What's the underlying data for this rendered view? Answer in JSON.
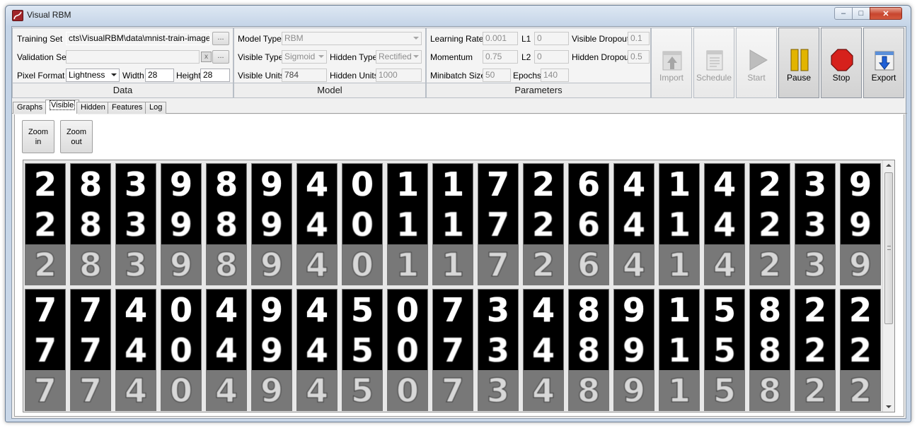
{
  "window": {
    "title": "Visual RBM",
    "minimize": "–",
    "maximize": "□",
    "close": "✕"
  },
  "data_panel": {
    "caption": "Data",
    "training_set_label": "Training Set",
    "training_set_value": "cts\\VisualRBM\\data\\mnist-train-images.idx",
    "validation_set_label": "Validation Set",
    "validation_set_value": "",
    "browse_label": "...",
    "clear_label": "x",
    "pixel_format_label": "Pixel Format",
    "pixel_format_value": "Lightness",
    "width_label": "Width",
    "width_value": "28",
    "height_label": "Height",
    "height_value": "28"
  },
  "model_panel": {
    "caption": "Model",
    "model_type_label": "Model Type",
    "model_type_value": "RBM",
    "visible_type_label": "Visible Type",
    "visible_type_value": "Sigmoid",
    "hidden_type_label": "Hidden Type",
    "hidden_type_value": "Rectified",
    "visible_units_label": "Visible Units",
    "visible_units_value": "784",
    "hidden_units_label": "Hidden Units",
    "hidden_units_value": "1000"
  },
  "parameters_panel": {
    "caption": "Parameters",
    "learning_rate_label": "Learning Rate",
    "learning_rate_value": "0.001",
    "l1_label": "L1",
    "l1_value": "0",
    "visible_dropout_label": "Visible Dropout",
    "visible_dropout_value": "0.1",
    "momentum_label": "Momentum",
    "momentum_value": "0.75",
    "l2_label": "L2",
    "l2_value": "0",
    "hidden_dropout_label": "Hidden Dropout",
    "hidden_dropout_value": "0.5",
    "minibatch_label": "Minibatch Size",
    "minibatch_value": "50",
    "epochs_label": "Epochs",
    "epochs_value": "140"
  },
  "toolbar": {
    "import_label": "Import",
    "schedule_label": "Schedule",
    "start_label": "Start",
    "pause_label": "Pause",
    "stop_label": "Stop",
    "export_label": "Export"
  },
  "tabs": [
    "Graphs",
    "Visible",
    "Hidden",
    "Features",
    "Log"
  ],
  "selected_tab": "Visible",
  "zoom": {
    "in_label_1": "Zoom",
    "in_label_2": "in",
    "out_label_1": "Zoom",
    "out_label_2": "out"
  },
  "digits": {
    "row1": [
      "2",
      "8",
      "3",
      "9",
      "8",
      "9",
      "4",
      "0",
      "1",
      "1",
      "7",
      "2",
      "6",
      "4",
      "1",
      "4",
      "2",
      "3",
      "9"
    ],
    "row2": [
      "7",
      "7",
      "4",
      "0",
      "4",
      "9",
      "4",
      "5",
      "0",
      "7",
      "3",
      "4",
      "8",
      "9",
      "1",
      "5",
      "8",
      "2",
      "2"
    ]
  },
  "colors": {
    "window_frame": "#c9d7e8",
    "tile_background": "#000000",
    "reconstruction_background": "#787878",
    "stop_red": "#d6211c",
    "pause_yellow": "#e2b400",
    "export_blue": "#1f5fd6"
  }
}
